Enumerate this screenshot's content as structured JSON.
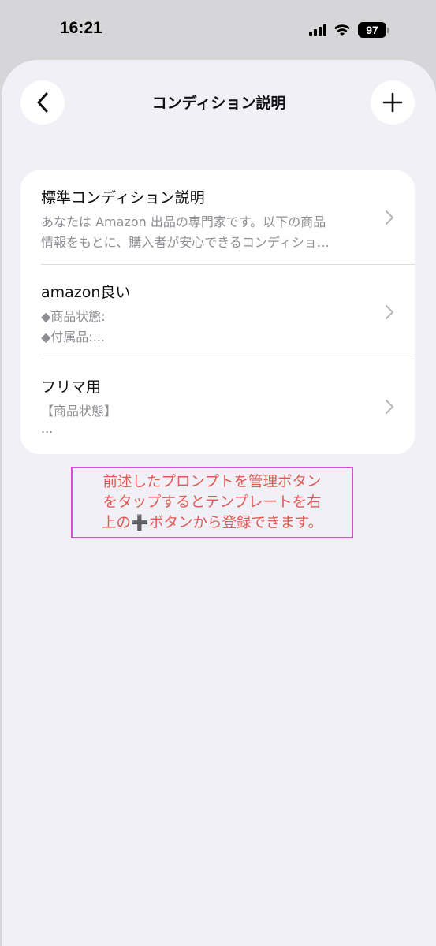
{
  "status_bar": {
    "time": "16:21",
    "battery": "97",
    "icons": [
      "signal-icon",
      "wifi-icon",
      "battery-icon"
    ]
  },
  "nav": {
    "title": "コンディション説明",
    "back_icon": "chevron-left-icon",
    "add_icon": "plus-icon"
  },
  "templates": [
    {
      "title": "標準コンディション説明",
      "line1": "あなたは Amazon 出品の専門家です。以下の商品",
      "line2": "情報をもとに、購入者が安心できるコンディショ…"
    },
    {
      "title": "amazon良い",
      "line1": "◆商品状態:",
      "line2": "◆付属品:..."
    },
    {
      "title": "フリマ用",
      "line1": "【商品状態】",
      "line2": "..."
    }
  ],
  "annotation": {
    "line1": "前述したプロンプトを管理ボタン",
    "line2": "をタップするとテンプレートを右",
    "line3": "上の➕ボタンから登録できます。"
  },
  "colors": {
    "background": "#f1f0f6",
    "card": "#ffffff",
    "annotation_text": "#e05a55",
    "annotation_border": "#d44fd8",
    "secondary_text": "#8e8e93"
  }
}
